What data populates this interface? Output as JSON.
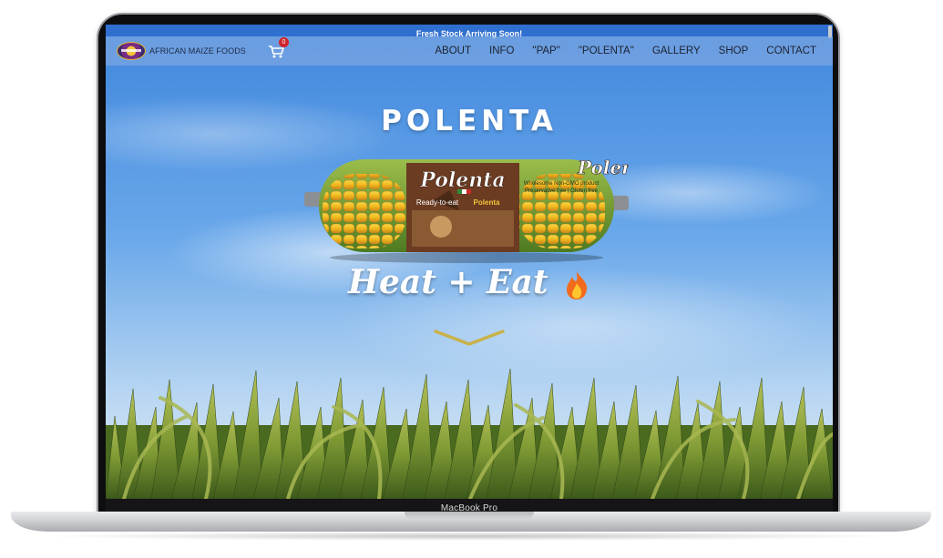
{
  "device": {
    "model_label": "MacBook Pro"
  },
  "announcement": {
    "text": "Fresh Stock Arriving Soon!"
  },
  "header": {
    "brand_name": "AFRICAN MAIZE FOODS",
    "cart_count": "0",
    "menu": [
      {
        "label": "ABOUT"
      },
      {
        "label": "INFO"
      },
      {
        "label": "\"PAP\""
      },
      {
        "label": "\"POLENTA\""
      },
      {
        "label": "GALLERY"
      },
      {
        "label": "SHOP"
      },
      {
        "label": "CONTACT"
      }
    ]
  },
  "hero": {
    "title": "POLENTA",
    "tagline": "Heat + Eat",
    "product": {
      "brand": "Polenta",
      "subtitle_a": "Ready-to-eat",
      "subtitle_b": "Polenta",
      "claims": "Wholesome Non-GMO product",
      "claims_2": "Preservative free | Gluten free"
    }
  },
  "colors": {
    "announcement_bg": "#2f6fd0",
    "cart_badge": "#d0232a",
    "chevron": "#c9b24a",
    "sky_top": "#3f86dd"
  },
  "icons": [
    "cart-icon",
    "fire-icon",
    "chevron-down-icon"
  ]
}
